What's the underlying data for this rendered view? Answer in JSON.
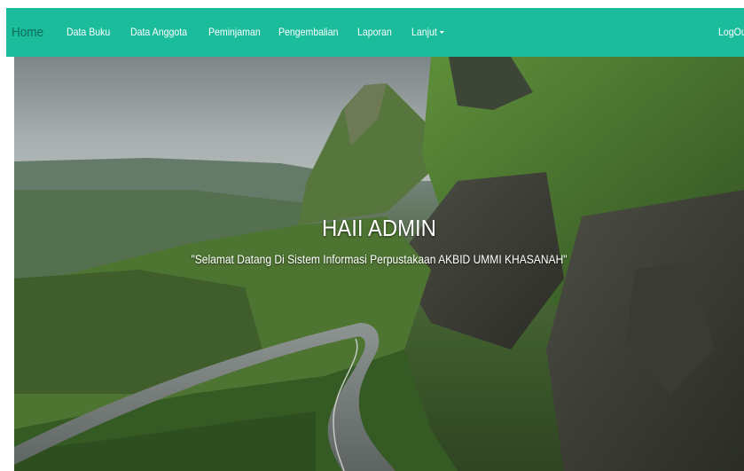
{
  "navbar": {
    "brand": "Home",
    "items": [
      {
        "label": "Data Buku"
      },
      {
        "label": "Data Anggota"
      },
      {
        "label": "Peminjaman"
      },
      {
        "label": "Pengembalian"
      },
      {
        "label": "Laporan"
      },
      {
        "label": "Lanjut",
        "icon": "caret-down-icon"
      }
    ],
    "logout": "LogOut"
  },
  "hero": {
    "title": "HAII ADMIN",
    "subtitle": "\"Selamat Datang Di Sistem Informasi Perpustakaan AKBID UMMI KHASANAH\""
  },
  "colors": {
    "navbar_bg": "#1abc9c",
    "brand_text": "#0f6b58",
    "nav_text": "#ffffff"
  }
}
